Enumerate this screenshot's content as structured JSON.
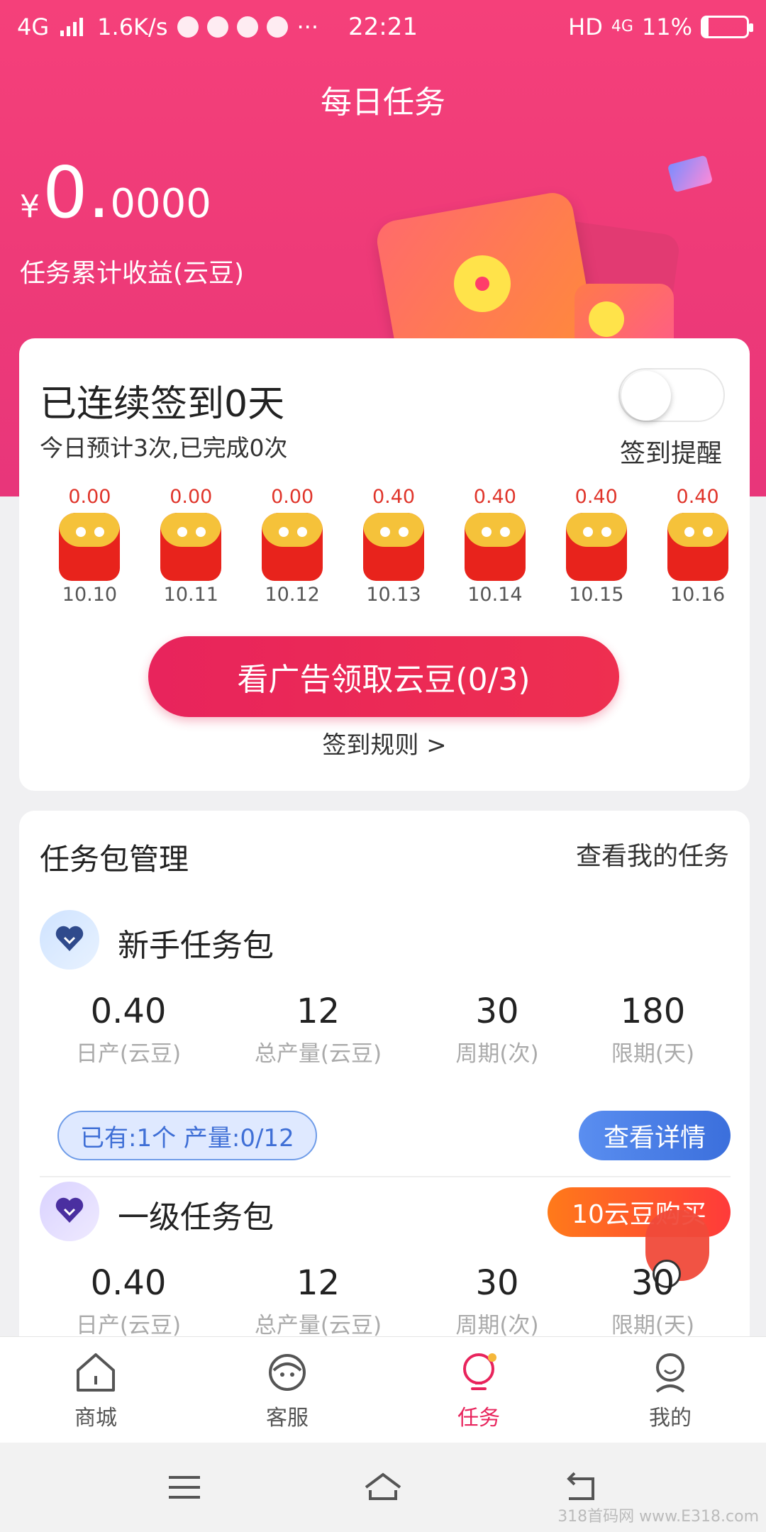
{
  "status_bar": {
    "network": "4G",
    "speed": "1.6K/s",
    "time": "22:21",
    "hd": "HD",
    "net_right": "4G",
    "battery": "11%"
  },
  "header": {
    "title": "每日任务",
    "currency": "¥",
    "amount_int": "0",
    "amount_dot": ".",
    "amount_dec": "0000",
    "earnings_label": "任务累计收益(云豆)"
  },
  "checkin": {
    "streak_title": "已连续签到0天",
    "progress": "今日预计3次,已完成0次",
    "reminder_label": "签到提醒",
    "reminder_on": false,
    "days": [
      {
        "amount": "0.00",
        "date": "10.10"
      },
      {
        "amount": "0.00",
        "date": "10.11"
      },
      {
        "amount": "0.00",
        "date": "10.12"
      },
      {
        "amount": "0.40",
        "date": "10.13"
      },
      {
        "amount": "0.40",
        "date": "10.14"
      },
      {
        "amount": "0.40",
        "date": "10.15"
      },
      {
        "amount": "0.40",
        "date": "10.16"
      }
    ],
    "ad_button": "看广告领取云豆(0/3)",
    "rules_link": "签到规则 >"
  },
  "packages": {
    "title": "任务包管理",
    "view_mine": "查看我的任务",
    "items": [
      {
        "name": "新手任务包",
        "stats": [
          {
            "value": "0.40",
            "label": "日产(云豆)"
          },
          {
            "value": "12",
            "label": "总产量(云豆)"
          },
          {
            "value": "30",
            "label": "周期(次)"
          },
          {
            "value": "180",
            "label": "限期(天)"
          }
        ],
        "owned": "已有:1个 产量:0/12",
        "action": "查看详情"
      },
      {
        "name": "一级任务包",
        "buy": "10云豆购买",
        "stats": [
          {
            "value": "0.40",
            "label": "日产(云豆)"
          },
          {
            "value": "12",
            "label": "总产量(云豆)"
          },
          {
            "value": "30",
            "label": "周期(次)"
          },
          {
            "value": "30",
            "label": "限期(天)"
          }
        ]
      }
    ]
  },
  "tabbar": {
    "items": [
      {
        "label": "商城",
        "icon": "house-icon"
      },
      {
        "label": "客服",
        "icon": "customer-service-icon"
      },
      {
        "label": "任务",
        "icon": "lightbulb-icon"
      },
      {
        "label": "我的",
        "icon": "profile-icon"
      }
    ],
    "active": 2
  },
  "watermark": "318首码网 www.E318.com",
  "colors": {
    "brand": "#ee3a78",
    "accent_blue": "#3b6fdc",
    "accent_orange": "#ff7a1a"
  }
}
